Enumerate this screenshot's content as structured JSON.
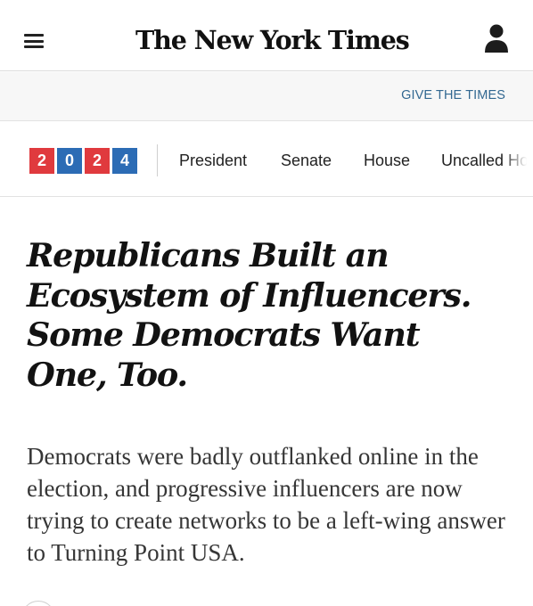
{
  "header": {
    "menu_icon": "hamburger-menu-icon",
    "logo_text": "The New York Times",
    "account_icon": "user-account-icon"
  },
  "promo": {
    "link_label": "GIVE THE TIMES"
  },
  "election_nav": {
    "badge_digits": [
      "2",
      "0",
      "2",
      "4"
    ],
    "badge_colors": [
      "#e03a3e",
      "#2c6cb5",
      "#e03a3e",
      "#2c6cb5"
    ],
    "items": [
      {
        "label": "President"
      },
      {
        "label": "Senate"
      },
      {
        "label": "House"
      },
      {
        "label": "Uncalled Ho"
      }
    ]
  },
  "article": {
    "headline": "Republicans Built an Ecosystem of Influencers. Some Democrats Want One, Too.",
    "summary": "Democrats were badly outflanked online in the election, and progressive influencers are now trying to create networks to be a left-wing answer to Turning Point USA."
  }
}
